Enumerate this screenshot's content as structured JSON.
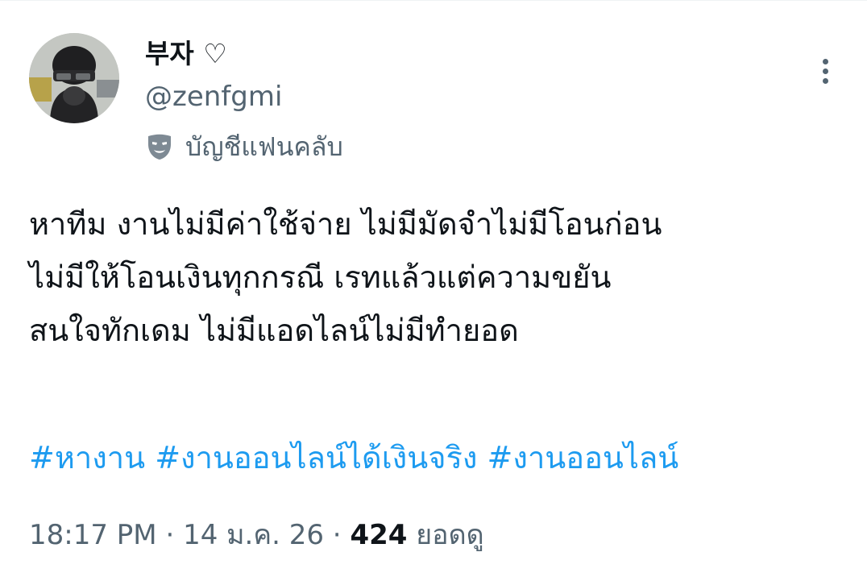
{
  "tweet": {
    "display_name": "부자 ♡",
    "handle": "@zenfgmi",
    "account_label": "บัญชีแฟนคลับ",
    "account_label_icon": "theater-mask-icon",
    "more_icon": "more-vertical-icon",
    "body_lines": [
      "หาทีม งานไม่มีค่าใช้จ่าย ไม่มีมัดจำไม่มีโอนก่อน",
      "ไม่มีให้โอนเงินทุกกรณี เรทแล้วแต่ความขยัน",
      "สนใจทักเดม ไม่มีแอดไลน์ไม่มีทำยอด"
    ],
    "hashtags": [
      "#หางาน",
      "#งานออนไลน์ได้เงินจริง",
      "#งานออนไลน์"
    ],
    "time": "18:17 PM",
    "date": "14 ม.ค. 26",
    "separator": " · ",
    "view_count": "424",
    "view_label": "ยอดดู"
  },
  "colors": {
    "text": "#0f1419",
    "secondary": "#536471",
    "link": "#1d9bf0"
  }
}
